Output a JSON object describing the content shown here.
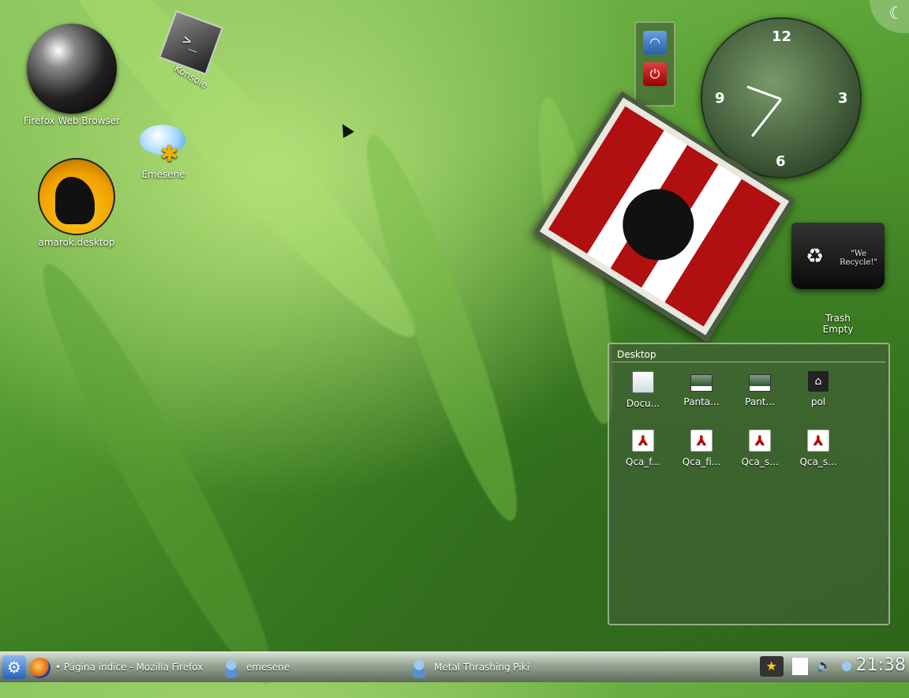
{
  "desktop": {
    "icons": [
      {
        "label": "Firefox Web Browser",
        "icon": "firefox-globe-icon"
      },
      {
        "label": "Konsole",
        "icon": "konsole-icon"
      },
      {
        "label": "Emesene",
        "icon": "emesene-icon"
      },
      {
        "label": "amarok.desktop",
        "icon": "amarok-wolf-icon"
      }
    ]
  },
  "clock_widget": {
    "n12": "12",
    "n3": "3",
    "n6": "6",
    "n9": "9"
  },
  "trash": {
    "label": "Trash",
    "status": "Empty",
    "slogan": "\"We Recycle!\""
  },
  "folderview": {
    "title": "Desktop",
    "items": [
      {
        "label": "Docu...",
        "icon": "document-icon"
      },
      {
        "label": "Panta...",
        "icon": "image-icon"
      },
      {
        "label": "Pant...",
        "icon": "image-icon"
      },
      {
        "label": "pol",
        "icon": "home-folder-icon"
      },
      {
        "label": "Qca_f...",
        "icon": "pdf-icon"
      },
      {
        "label": "Qca_fi...",
        "icon": "pdf-icon"
      },
      {
        "label": "Qca_s...",
        "icon": "pdf-icon"
      },
      {
        "label": "Qca_s...",
        "icon": "pdf-icon"
      }
    ]
  },
  "taskbar": {
    "tasks": [
      {
        "label": "• Página índice - Mozilla Firefox",
        "icon": "firefox-icon"
      },
      {
        "label": "emesene",
        "icon": "emesene-user-icon"
      },
      {
        "label": "Metal Thrashing Piki",
        "icon": "emesene-busy-user-icon"
      }
    ],
    "clock": "21:38"
  }
}
